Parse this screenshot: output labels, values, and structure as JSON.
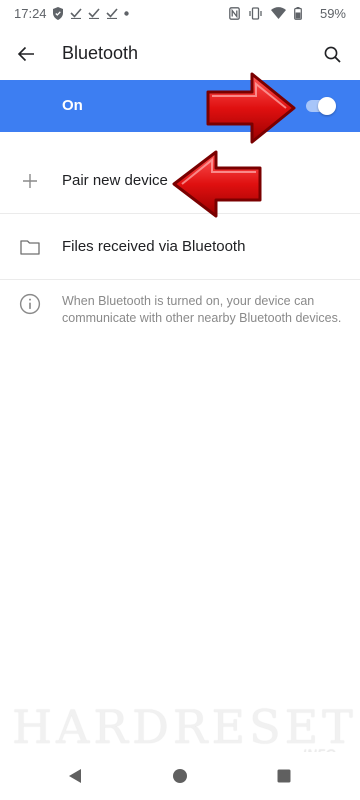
{
  "status_bar": {
    "time": "17:24",
    "battery": "59%"
  },
  "app_bar": {
    "title": "Bluetooth"
  },
  "master_switch": {
    "label": "On",
    "state": "on",
    "accent_color": "#3d7ef2"
  },
  "items": [
    {
      "label": "Pair new device",
      "icon": "plus-icon"
    },
    {
      "label": "Files received via Bluetooth",
      "icon": "folder-icon"
    }
  ],
  "info": {
    "text": "When Bluetooth is turned on, your device can communicate with other nearby Bluetooth devices.",
    "icon": "info-icon"
  },
  "watermark": {
    "main": "HARDRESET",
    "sub": ".INFO"
  }
}
